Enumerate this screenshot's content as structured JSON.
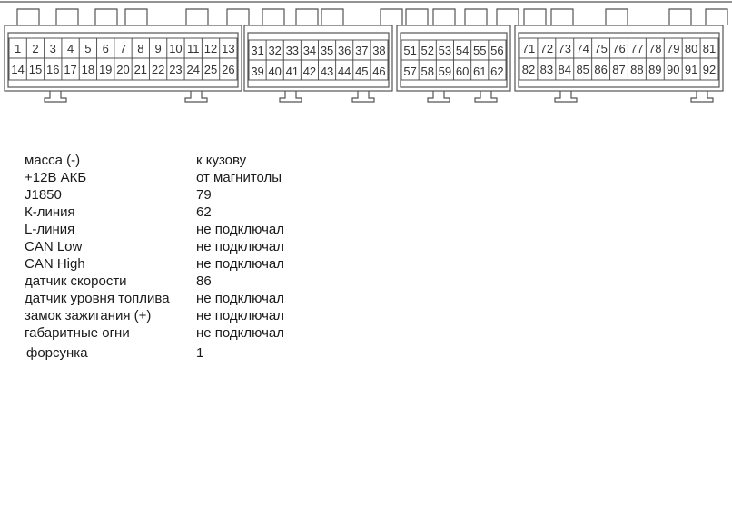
{
  "connectors": [
    {
      "id": "A",
      "top_row": [
        "1",
        "2",
        "3",
        "4",
        "5",
        "6",
        "7",
        "8",
        "9",
        "10",
        "11",
        "12",
        "13"
      ],
      "bottom_row": [
        "14",
        "15",
        "16",
        "17",
        "18",
        "19",
        "20",
        "21",
        "22",
        "23",
        "24",
        "25",
        "26"
      ]
    },
    {
      "id": "B",
      "top_row": [
        "31",
        "32",
        "33",
        "34",
        "35",
        "36",
        "37",
        "38"
      ],
      "bottom_row": [
        "39",
        "40",
        "41",
        "42",
        "43",
        "44",
        "45",
        "46"
      ]
    },
    {
      "id": "C",
      "top_row": [
        "51",
        "52",
        "53",
        "54",
        "55",
        "56"
      ],
      "bottom_row": [
        "57",
        "58",
        "59",
        "60",
        "61",
        "62"
      ]
    },
    {
      "id": "D",
      "top_row": [
        "71",
        "72",
        "73",
        "74",
        "75",
        "76",
        "77",
        "78",
        "79",
        "80",
        "81"
      ],
      "bottom_row": [
        "82",
        "83",
        "84",
        "85",
        "86",
        "87",
        "88",
        "89",
        "90",
        "91",
        "92"
      ]
    }
  ],
  "pinout": [
    {
      "signal": "масса (-)",
      "value": "к кузову"
    },
    {
      "signal": "+12В АКБ",
      "value": "от магнитолы"
    },
    {
      "signal": "J1850",
      "value": "79"
    },
    {
      "signal": "К-линия",
      "value": "62"
    },
    {
      "signal": "L-линия",
      "value": "не подключал"
    },
    {
      "signal": "CAN Low",
      "value": "не подключал"
    },
    {
      "signal": "CAN High",
      "value": "не подключал"
    },
    {
      "signal": "датчик скорости",
      "value": "86"
    },
    {
      "signal": "датчик уровня топлива",
      "value": "не подключал"
    },
    {
      "signal": "замок зажигания (+)",
      "value": "не подключал"
    },
    {
      "signal": "габаритные огни",
      "value": "не подключал"
    },
    {
      "signal": "форсунка",
      "value": "1"
    }
  ],
  "colors": {
    "line": "#555555",
    "text": "#1a1a1a"
  }
}
